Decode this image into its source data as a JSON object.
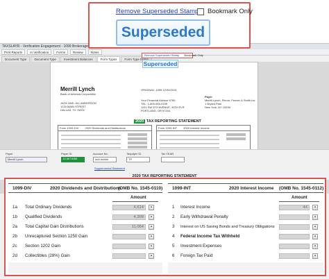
{
  "app": {
    "title": "TAXSLAYR - Verification Engagement - 1099 Brokerage Statement - Merrill Lynch 2020 - Review",
    "toolbar": [
      "Print Reports",
      "In Verification",
      "Forms",
      "Review",
      "Notes"
    ],
    "tabs": [
      "Document Type",
      "Document Type",
      "Investment Balances",
      "Form Types",
      "Form Type Detail"
    ]
  },
  "callout_top": {
    "remove_link": "Remove Superseded Stamp",
    "bookmark_label": "Bookmark Only",
    "bookmark_checked": false,
    "stamp_text": "Superseded"
  },
  "mini": {
    "remove_link": "Remove Superseded Stamp",
    "bookmark_label": "Bookmark Only",
    "stamp_text": "Superseded"
  },
  "statement": {
    "brand": "Merrill Lynch",
    "brand_sub": "Bank of America Corporation",
    "original_line": "ORIGINAL: 1099 12/30/2019",
    "payer_label": "Payer",
    "recipient_name": "JACK AND JILL ANDERSON",
    "recipient_addr1": "1234 MAIN STREET",
    "recipient_addr2": "DALLAS, TX 75202",
    "advisor_lines": [
      "Your Financial Advisor 6789",
      "TEL: 1-800-555-0199",
      "1101 SW 5TH AVENUE, 30TH FLR",
      "PORTLAND, OR 97204"
    ],
    "payer_lines": [
      "Merrill Lynch, Pierce, Fenner & Smith Inc",
      "1 Bryant Park",
      "New York, NY 10036"
    ],
    "year_word": "2020",
    "heading": "TAX REPORTING STATEMENT",
    "left_form": "Form 1099-DIV",
    "left_title": "2020 Dividends and Distributions",
    "right_form": "Form 1099-INT",
    "right_title": "2020 Interest Income",
    "footnote": "* Nonbusiness Notes"
  },
  "fields": {
    "payer_label": "Payer",
    "payer_value": "Merrill Lynch",
    "payer_id_label": "Payer ID",
    "payer_id_value": "13-5674085",
    "account_label": "Account No.",
    "account_value": "###-#####",
    "taxpayer_label": "Taxpayer ID",
    "taxpayer_value": "TP",
    "tax_year_label": "Tax YEAR",
    "supplemental_link": "Supplemental Statement"
  },
  "form_heading": "2020 TAX REPORTING STATEMENT",
  "div": {
    "form": "1099-DIV",
    "title": "2020 Dividends and Distributions",
    "omb": "(OMB No. 1545-0110)",
    "amount_label": "Amount",
    "rows": [
      {
        "num": "1a",
        "label": "Total Ordinary Dividends",
        "value": "4,614"
      },
      {
        "num": "1b",
        "label": "Qualified Dividends",
        "value": "4,309"
      },
      {
        "num": "2a",
        "label": "Total Capital Gain Distributions",
        "value": "11,064"
      },
      {
        "num": "2b",
        "label": "Unrecaptured Section 1250 Gain",
        "value": ""
      },
      {
        "num": "2c",
        "label": "Section 1202 Gain",
        "value": ""
      },
      {
        "num": "2d",
        "label": "Collectibles (28%) Gain",
        "value": ""
      }
    ]
  },
  "int": {
    "form": "1099-INT",
    "title": "2020 Interest Income",
    "omb": "(OMB No. 1545-0112)",
    "amount_label": "Amount",
    "rows": [
      {
        "num": "1",
        "label": "Interest Income",
        "value": "44",
        "bold": false
      },
      {
        "num": "2",
        "label": "Early Withdrawal Penalty",
        "value": "",
        "bold": false
      },
      {
        "num": "3",
        "label": "Interest on US Saving Bonds and Treasury Obligations",
        "value": "",
        "bold": false
      },
      {
        "num": "4",
        "label": "Federal Income Tax Withheld",
        "value": "",
        "bold": true
      },
      {
        "num": "5",
        "label": "Investment Expenses",
        "value": "",
        "bold": false
      },
      {
        "num": "6",
        "label": "Foreign Tax Paid",
        "value": "",
        "bold": false
      }
    ]
  },
  "colors": {
    "callout_border": "#d9534f",
    "stamp_text": "#2c78c9",
    "link": "#1f3fb6",
    "year_badge": "#1f8f3b"
  }
}
